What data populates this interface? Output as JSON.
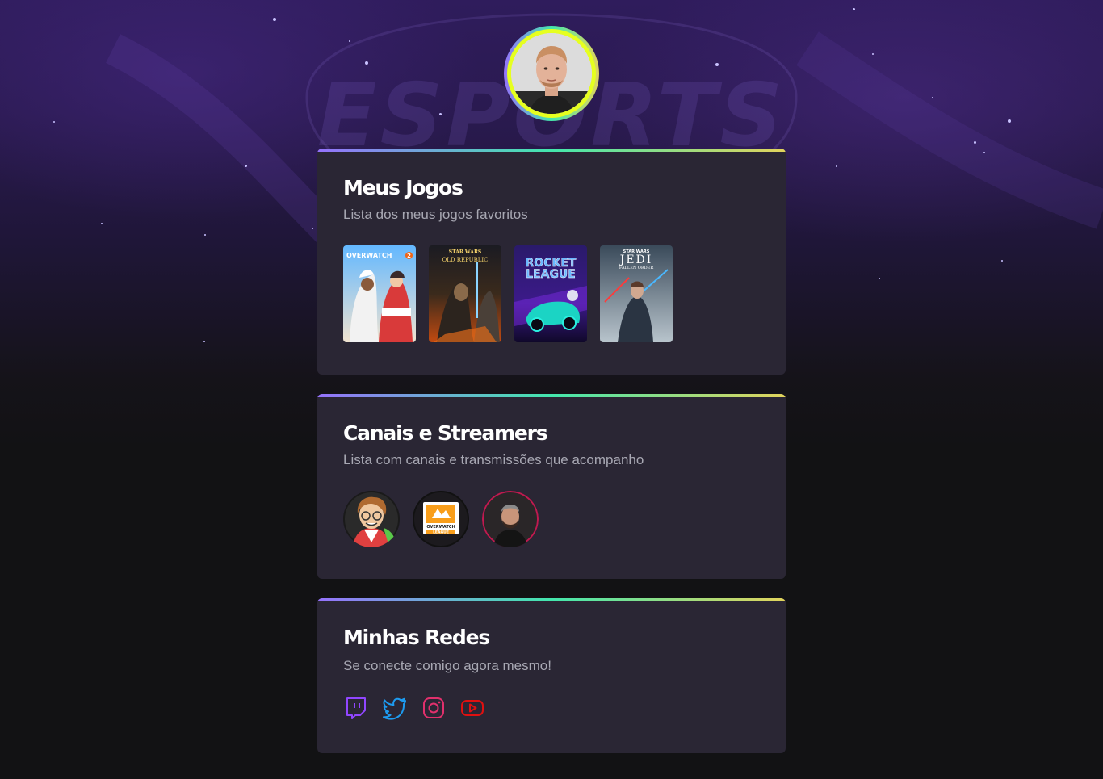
{
  "profile": {
    "avatar_icon": "profile-photo"
  },
  "colors": {
    "card_bg": "#2a2634",
    "page_bg": "#121214",
    "gradient": [
      "#9572fc",
      "#43e7ad",
      "#e2d45c"
    ],
    "avatar_ring": "#e6ff1f",
    "subtitle": "#a8a8b3",
    "twitch": "#9146ff",
    "twitter": "#1d9bf0",
    "instagram": "#e1306c",
    "youtube": "#ff0000"
  },
  "games_card": {
    "title": "Meus Jogos",
    "subtitle": "Lista dos meus jogos favoritos",
    "games": [
      {
        "name": "Overwatch 2",
        "cover_text": "OVERWATCH",
        "badge": "2"
      },
      {
        "name": "Star Wars Old Republic",
        "cover_text_top": "STAR WARS",
        "cover_text": "OLD REPUBLIC"
      },
      {
        "name": "Rocket League",
        "cover_text_top": "ROCKET",
        "cover_text": "LEAGUE"
      },
      {
        "name": "Star Wars Jedi Fallen Order",
        "cover_text_top": "STAR WARS",
        "cover_text": "JEDI",
        "cover_text_sub": "FALLEN ORDER"
      }
    ]
  },
  "channels_card": {
    "title": "Canais e Streamers",
    "subtitle": "Lista com canais e transmissões que acompanho",
    "channels": [
      {
        "icon": "cartoon-avatar"
      },
      {
        "icon": "overwatch-league-logo",
        "logo_text_top": "OVERWATCH",
        "logo_text_bottom": "LEAGUE"
      },
      {
        "icon": "streamer-avatar"
      }
    ]
  },
  "social_card": {
    "title": "Minhas Redes",
    "subtitle": "Se conecte comigo agora mesmo!",
    "links": [
      {
        "icon": "twitch-icon"
      },
      {
        "icon": "twitter-icon"
      },
      {
        "icon": "instagram-icon"
      },
      {
        "icon": "youtube-icon"
      }
    ]
  },
  "background": {
    "watermark_text": "ESPORTS"
  }
}
